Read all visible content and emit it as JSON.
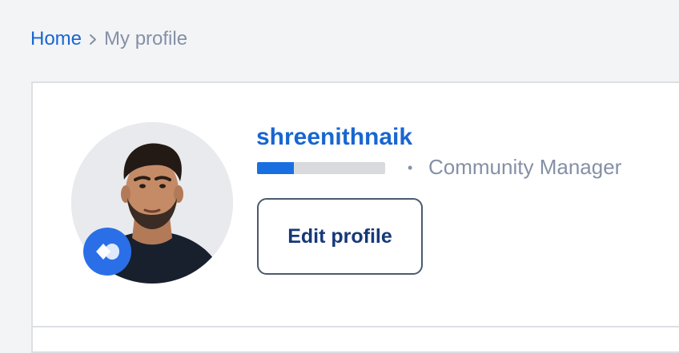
{
  "breadcrumb": {
    "home_label": "Home",
    "separator_icon": "chevron-right-icon",
    "current_label": "My profile"
  },
  "profile": {
    "username": "shreenithnaik",
    "rank_progress": 0.29,
    "role": "Community Manager",
    "role_separator": "•",
    "avatar_icon": "user-photo",
    "badge_icon": "community-badge-icon",
    "edit_button_label": "Edit profile"
  },
  "colors": {
    "link": "#1866d1",
    "muted_text": "#8590a6",
    "progress_fill": "#1a6fe0",
    "progress_track": "#d9dadd",
    "badge": "#2a6fe8",
    "button_text": "#16387a",
    "button_border": "#4a5a6e",
    "page_background": "#f3f4f6",
    "card_border": "#dde0e3"
  }
}
